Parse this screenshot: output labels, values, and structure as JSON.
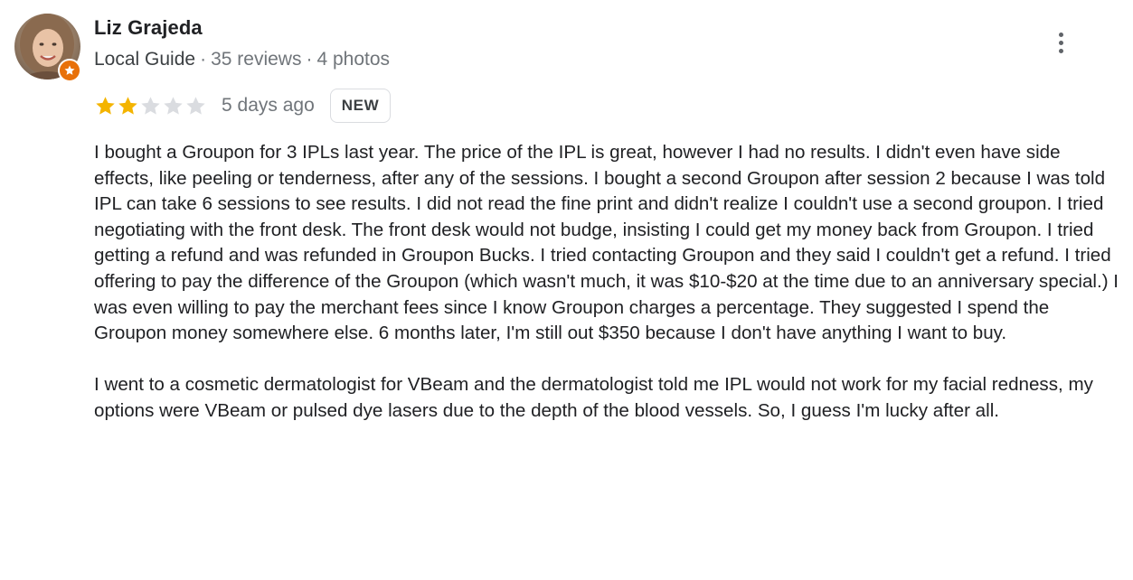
{
  "reviewer": {
    "name": "Liz Grajeda",
    "guide_label": "Local Guide",
    "separator": "·",
    "review_count": "35 reviews",
    "photo_count": "4 photos",
    "avatar_icon": "avatar-photo",
    "badge_icon": "local-guide-star-badge",
    "badge_color": "#e8710a"
  },
  "rating": {
    "stars": 2,
    "max_stars": 5,
    "filled_color": "#f4b400",
    "empty_color": "#dadce0",
    "date": "5 days ago",
    "badge": "NEW"
  },
  "menu": {
    "icon": "more-vert-icon"
  },
  "review": {
    "paragraphs": [
      "I bought a Groupon for 3 IPLs last year. The price of the IPL is great, however I had no results. I didn't even have side effects, like peeling or tenderness, after any of the sessions. I bought a second Groupon after session 2 because I was told IPL can take 6 sessions to see results. I did not read the fine print and didn't realize I couldn't use a second groupon. I tried negotiating with the front desk. The front desk would not budge, insisting I could get my money back from Groupon. I tried getting a refund and was refunded in Groupon Bucks. I tried contacting Groupon and they said I couldn't get a refund. I tried offering to pay the difference of the Groupon (which wasn't much, it was $10-$20 at the time due to an anniversary special.) I was even willing to pay the merchant fees since I know Groupon charges a percentage. They suggested I spend the Groupon money somewhere else. 6 months later, I'm still out $350 because I don't have anything I want to buy.",
      "I went to a cosmetic dermatologist for VBeam and the dermatologist told me IPL would not work for my facial redness, my options were VBeam or pulsed dye lasers due to the depth of the blood vessels. So, I guess I'm lucky after all."
    ]
  }
}
